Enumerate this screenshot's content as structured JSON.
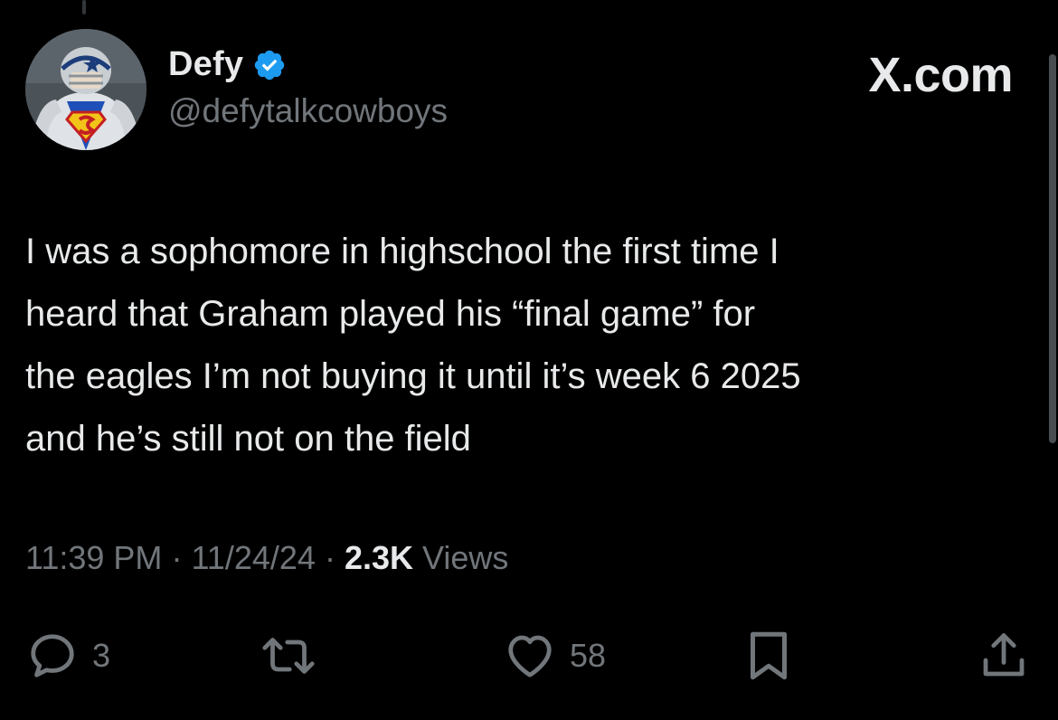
{
  "header": {
    "display_name": "Defy",
    "handle": "@defytalkcowboys",
    "site_label": "X.com",
    "verified": true
  },
  "tweet": {
    "text": "I was a sophomore in highschool the first time I\nheard that Graham played his “final game” for\nthe eagles I’m not buying it until it’s week 6 2025\nand he’s still not on the field"
  },
  "meta": {
    "time": "11:39 PM",
    "separator": "·",
    "date": "11/24/24",
    "views_count": "2.3K",
    "views_label": "Views"
  },
  "actions": {
    "reply_count": "3",
    "retweet_count": "",
    "like_count": "58"
  },
  "icons": {
    "reply": "reply-icon",
    "retweet": "retweet-icon",
    "like": "heart-icon",
    "bookmark": "bookmark-icon",
    "share": "share-icon",
    "verified": "verified-badge-icon"
  },
  "colors": {
    "background": "#000000",
    "primary_text": "#e7e9ea",
    "secondary_text": "#71767b",
    "verified_blue": "#1d9bf0"
  }
}
